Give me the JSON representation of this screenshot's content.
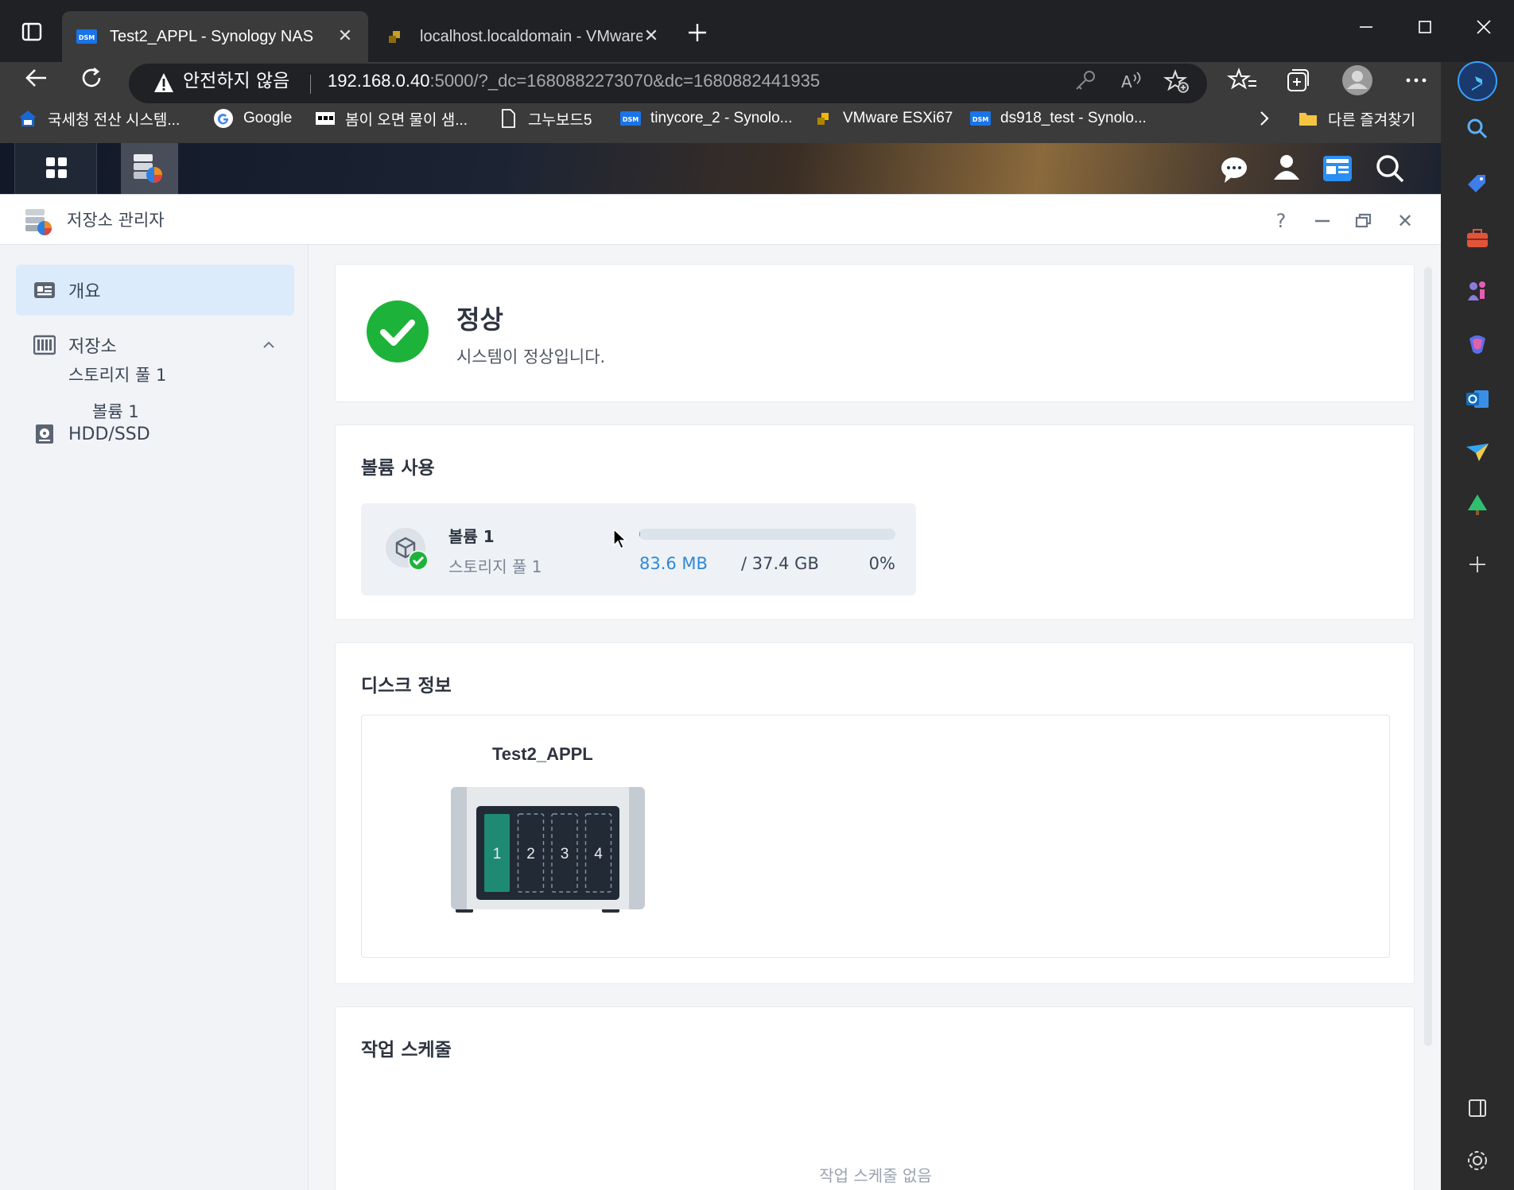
{
  "browser": {
    "tabs": [
      {
        "title": "Test2_APPL - Synology NAS",
        "favicon": "DSM",
        "active": true
      },
      {
        "title": "localhost.localdomain - VMware",
        "favicon": "vmware",
        "active": false
      }
    ],
    "security_warning": "안전하지 않음",
    "url_host": "192.168.0.40",
    "url_rest": ":5000/?_dc=1680882273070&dc=1680882441935",
    "bookmarks": [
      {
        "label": "국세청 전산 시스템...",
        "icon": "hometax-icon"
      },
      {
        "label": "Google",
        "icon": "google-icon"
      },
      {
        "label": "봄이 오면 물이 샘...",
        "icon": "blog-icon"
      },
      {
        "label": "그누보드5",
        "icon": "page-icon"
      },
      {
        "label": "tinycore_2 - Synolo...",
        "icon": "dsm-icon"
      },
      {
        "label": "VMware ESXi67",
        "icon": "vmware-icon"
      },
      {
        "label": "ds918_test - Synolo...",
        "icon": "dsm-icon"
      }
    ],
    "other_favorites": "다른 즐겨찾기",
    "favicon_text": "DSM"
  },
  "app": {
    "title": "저장소 관리자",
    "help_glyph": "?",
    "close_glyph": "✕"
  },
  "sidebar": {
    "overview": "개요",
    "storage": "저장소",
    "storage_pool": "스토리지 풀 1",
    "volume": "볼륨 1",
    "hdd": "HDD/SSD"
  },
  "status": {
    "title": "정상",
    "message": "시스템이 정상입니다."
  },
  "volume_usage": {
    "section_title": "볼륨 사용",
    "name": "볼륨 1",
    "pool": "스토리지 풀 1",
    "used": "83.6 MB",
    "separator_total": "/ 37.4 GB",
    "percent_label": "0%",
    "percent_value": 0.2
  },
  "disk_info": {
    "section_title": "디스크 정보",
    "nas_name": "Test2_APPL",
    "bays": [
      "1",
      "2",
      "3",
      "4"
    ],
    "occupied_bays": [
      1
    ]
  },
  "task_schedule": {
    "section_title": "작업 스케줄",
    "empty_text": "작업 스케줄 없음"
  },
  "colors": {
    "accent": "#2aa5f7",
    "status_ok": "#1db33a",
    "disk_occupied": "#1e8a74"
  }
}
